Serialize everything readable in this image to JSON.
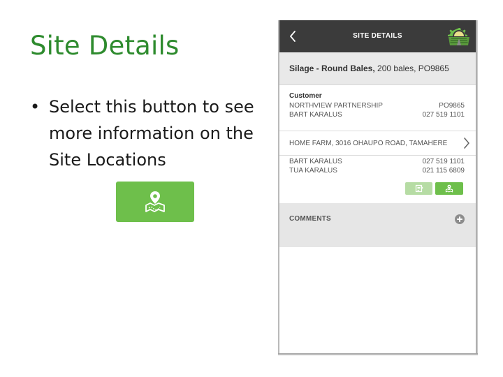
{
  "slide": {
    "title": "Site Details",
    "bullet": "Select this button to see more information on the Site Locations",
    "bullet_marker": "•",
    "button_icon": "map-location-icon"
  },
  "app": {
    "header": {
      "title": "SITE DETAILS",
      "back_icon": "chevron-left-icon",
      "logo_icon": "field-logo-icon"
    },
    "product": {
      "name": "Silage - Round Bales,",
      "detail": " 200 bales, PO9865"
    },
    "customer": {
      "label": "Customer",
      "name": "NORTHVIEW PARTNERSHIP",
      "po": "PO9865",
      "contact_name": "BART KARALUS",
      "contact_phone": "027 519 1101"
    },
    "site": {
      "address": "HOME FARM, 3016 OHAUPO ROAD, TAMAHERE",
      "chevron_icon": "chevron-right-icon",
      "contacts": [
        {
          "name": "BART KARALUS",
          "phone": "027 519 1101"
        },
        {
          "name": "TUA KARALUS",
          "phone": "021 115 6809"
        }
      ],
      "notes_button_icon": "notes-icon",
      "map_button_icon": "map-location-icon"
    },
    "comments": {
      "label": "COMMENTS",
      "add_icon": "plus-circle-icon"
    }
  },
  "colors": {
    "title_green": "#2e8b2e",
    "button_green": "#6ebf4b",
    "light_green": "#b6dca4",
    "header_dark": "#3b3b3b"
  }
}
